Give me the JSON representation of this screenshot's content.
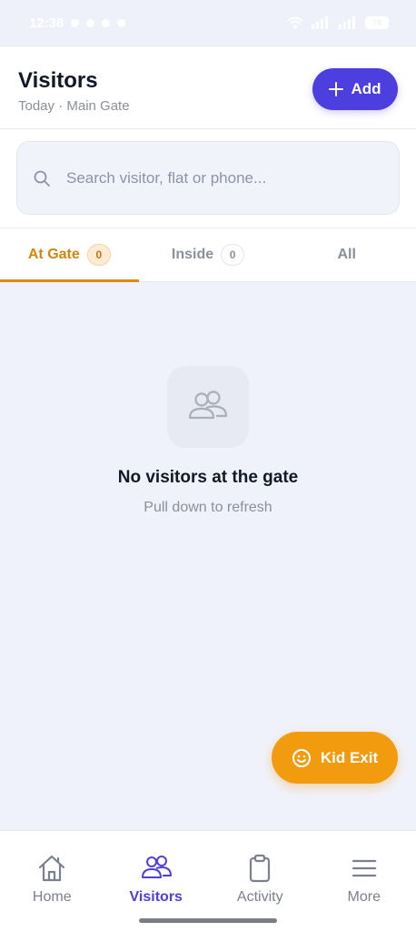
{
  "status_bar": {
    "time": "12:38",
    "battery": "78"
  },
  "header": {
    "title": "Visitors",
    "subtitle": "Today · Main Gate",
    "add_label": "Add"
  },
  "search": {
    "placeholder": "Search visitor, flat or phone..."
  },
  "tabs": [
    {
      "label": "At Gate",
      "count": "0",
      "active": true
    },
    {
      "label": "Inside",
      "count": "0",
      "active": false
    },
    {
      "label": "All",
      "active": false
    }
  ],
  "empty_state": {
    "title": "No visitors at the gate",
    "subtitle": "Pull down to refresh",
    "icon": "users-icon"
  },
  "fab": {
    "label": "Kid Exit",
    "icon": "smile-icon"
  },
  "bottom_nav": [
    {
      "label": "Home",
      "icon": "home-icon",
      "active": false
    },
    {
      "label": "Visitors",
      "icon": "users-icon",
      "active": true
    },
    {
      "label": "Activity",
      "icon": "clipboard-icon",
      "active": false
    },
    {
      "label": "More",
      "icon": "menu-icon",
      "active": false
    }
  ],
  "colors": {
    "primary": "#4d3ee0",
    "accent": "#f29b0f",
    "active_tab": "#d4860b",
    "background": "#f0f2fb"
  }
}
